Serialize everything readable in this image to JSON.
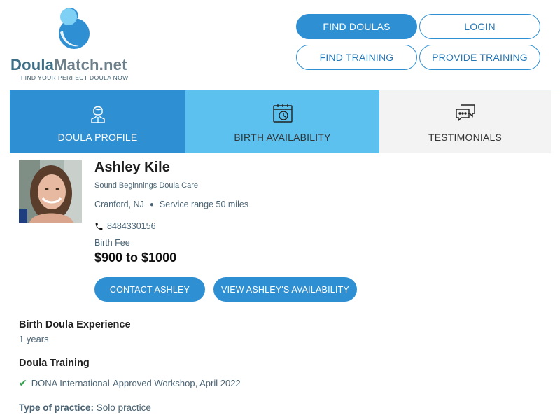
{
  "logo": {
    "name_part1": "Doula",
    "name_part2": "Match.net",
    "tagline": "FIND YOUR PERFECT DOULA NOW"
  },
  "colors": {
    "primary": "#2e8fd3",
    "tab_active": "#2e8fd3",
    "tab_light": "#5cc1ef",
    "tab_gray": "#f3f3f3",
    "check": "#2fa24b"
  },
  "header_buttons": {
    "find_doulas": "FIND DOULAS",
    "login": "LOGIN",
    "find_training": "FIND TRAINING",
    "provide_training": "PROVIDE TRAINING"
  },
  "tabs": [
    {
      "label": "DOULA PROFILE",
      "icon": "person-icon"
    },
    {
      "label": "BIRTH AVAILABILITY",
      "icon": "calendar-clock-icon"
    },
    {
      "label": "TESTIMONIALS",
      "icon": "chat-bubbles-icon"
    }
  ],
  "profile": {
    "name": "Ashley Kile",
    "organization": "Sound Beginnings Doula Care",
    "location": "Cranford, NJ",
    "service_range": "Service range 50 miles",
    "phone": "8484330156",
    "fee_label": "Birth Fee",
    "fee": "$900 to $1000",
    "contact_button": "CONTACT ASHLEY",
    "availability_button": "VIEW ASHLEY'S AVAILABILITY"
  },
  "experience": {
    "title": "Birth Doula Experience",
    "value": "1 years"
  },
  "training": {
    "title": "Doula Training",
    "items": [
      "DONA International-Approved Workshop, April 2022"
    ]
  },
  "practice": {
    "label": "Type of practice:",
    "value": "Solo practice"
  }
}
